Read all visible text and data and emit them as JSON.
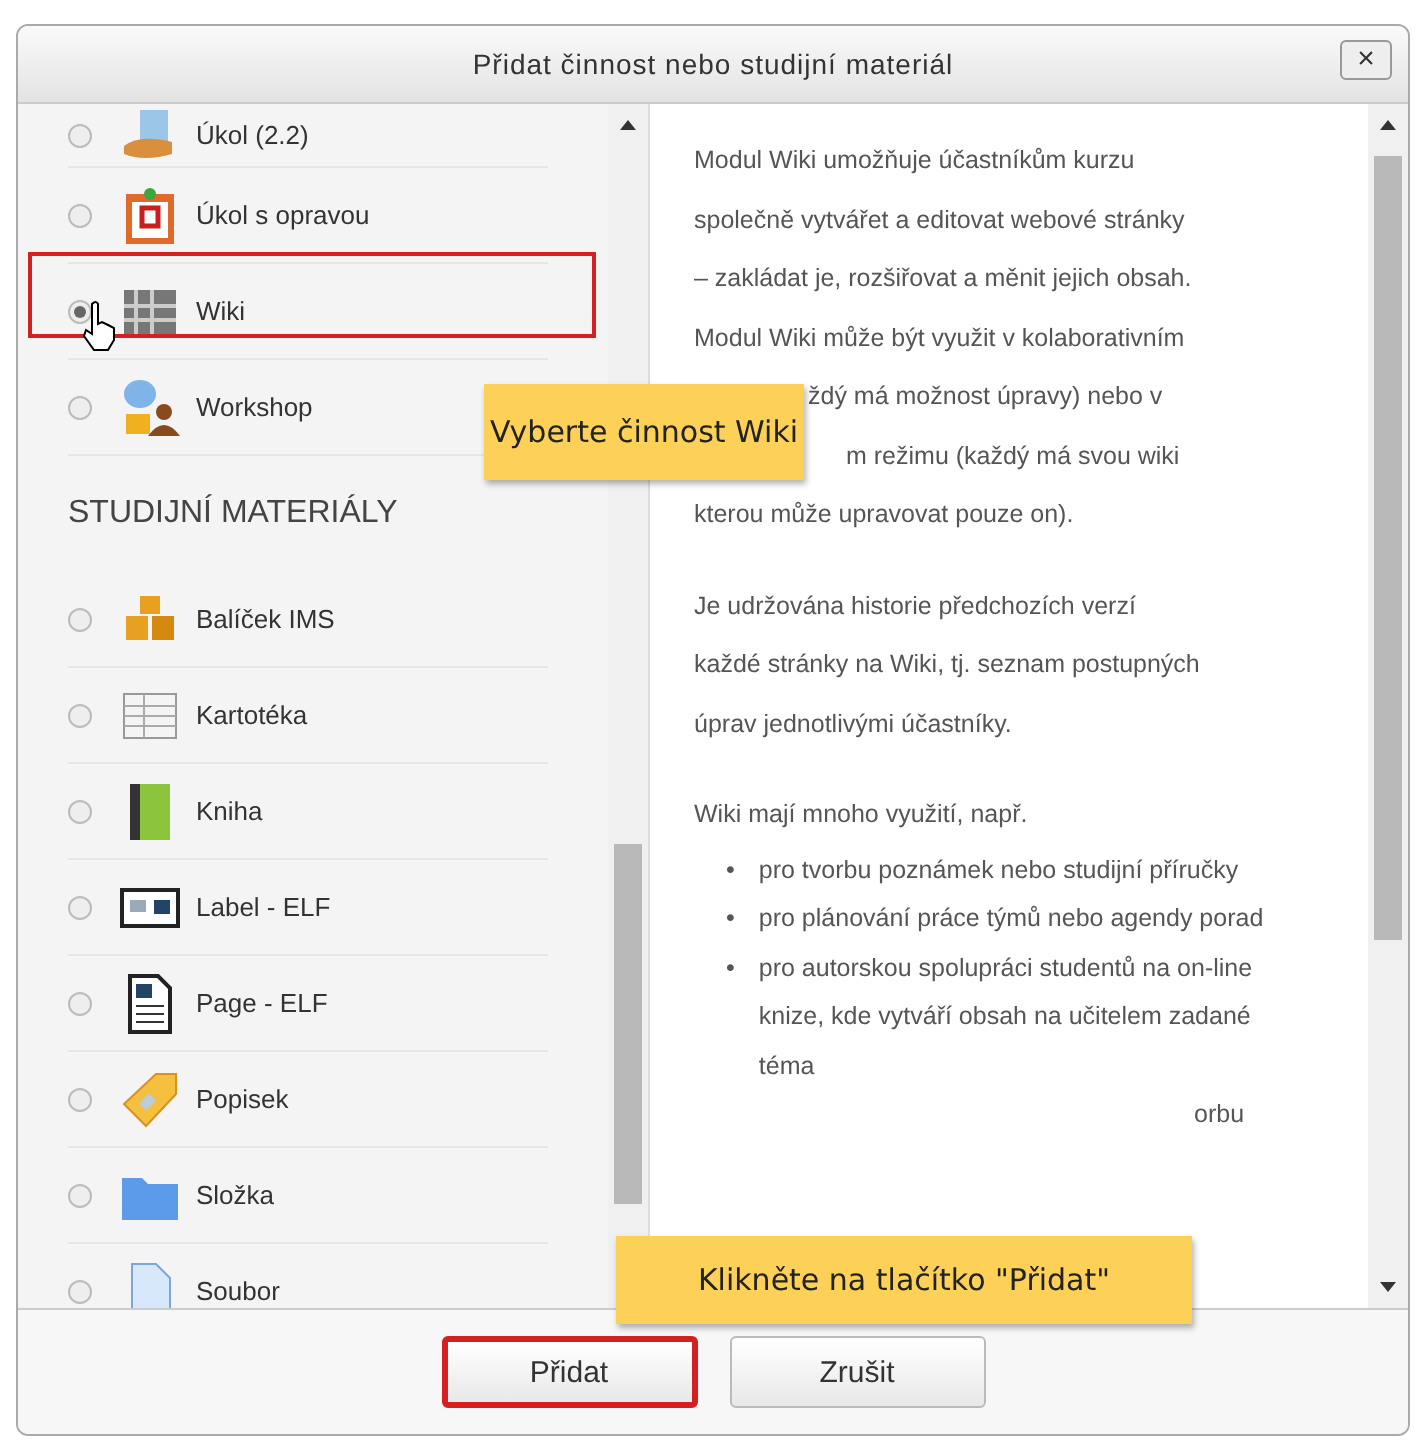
{
  "dialog": {
    "title": "Přidat činnost nebo studijní materiál",
    "close": "×"
  },
  "list": [
    {
      "kind": "item",
      "label": "Úkol (2.2)",
      "selected": false,
      "highlighted": false
    },
    {
      "kind": "item",
      "label": "Úkol s opravou",
      "selected": false,
      "highlighted": false
    },
    {
      "kind": "item",
      "label": "Wiki",
      "selected": true,
      "highlighted": true
    },
    {
      "kind": "item",
      "label": "Workshop",
      "selected": false,
      "highlighted": false
    },
    {
      "kind": "header",
      "label": "STUDIJNÍ MATERIÁLY"
    },
    {
      "kind": "item",
      "label": "Balíček IMS",
      "selected": false,
      "highlighted": false
    },
    {
      "kind": "item",
      "label": "Kartotéka",
      "selected": false,
      "highlighted": false
    },
    {
      "kind": "item",
      "label": "Kniha",
      "selected": false,
      "highlighted": false
    },
    {
      "kind": "item",
      "label": "Label - ELF",
      "selected": false,
      "highlighted": false
    },
    {
      "kind": "item",
      "label": "Page - ELF",
      "selected": false,
      "highlighted": false
    },
    {
      "kind": "item",
      "label": "Popisek",
      "selected": false,
      "highlighted": false
    },
    {
      "kind": "item",
      "label": "Složka",
      "selected": false,
      "highlighted": false
    },
    {
      "kind": "item",
      "label": "Soubor",
      "selected": false,
      "highlighted": false
    }
  ],
  "description": [
    {
      "kind": "line",
      "text": "Modul Wiki umožňuje účastníkům kurzu"
    },
    {
      "kind": "line",
      "text": "společně vytvářet a editovat webové stránky"
    },
    {
      "kind": "line",
      "text": "– zakládat je, rozšiřovat a měnit jejich obsah."
    },
    {
      "kind": "line",
      "text": "Modul Wiki může být využit v kolaborativním"
    },
    {
      "kind": "covered",
      "text": "ždý má možnost úpravy) nebo v"
    },
    {
      "kind": "covered",
      "text": "m režimu (každý má svou wiki"
    },
    {
      "kind": "line",
      "text": "kterou může upravovat pouze on)."
    },
    {
      "kind": "break"
    },
    {
      "kind": "line",
      "text": "Je udržována historie předchozích verzí"
    },
    {
      "kind": "line",
      "text": "každé stránky na Wiki, tj. seznam postupných"
    },
    {
      "kind": "line",
      "text": "úprav jednotlivými účastníky."
    },
    {
      "kind": "break"
    },
    {
      "kind": "line",
      "text": "Wiki mají mnoho využití, např."
    },
    {
      "kind": "bullet",
      "bullet": "•",
      "text": "pro tvorbu poznámek nebo studijní příručky"
    },
    {
      "kind": "bullet",
      "bullet": "•",
      "text": "pro plánování práce týmů nebo agendy porad"
    },
    {
      "kind": "bullet",
      "bullet": "•",
      "text": "pro autorskou spolupráci studentů na on-line knize, kde vytváří obsah na učitelem zadané téma"
    },
    {
      "kind": "covered",
      "text": "orbu"
    }
  ],
  "callouts": [
    "Vyberte činnost Wiki",
    "Klikněte na tlačítko \"Přidat\""
  ],
  "buttons": [
    {
      "label": "Přidat",
      "highlighted": true
    },
    {
      "label": "Zrušit",
      "highlighted": false
    }
  ]
}
